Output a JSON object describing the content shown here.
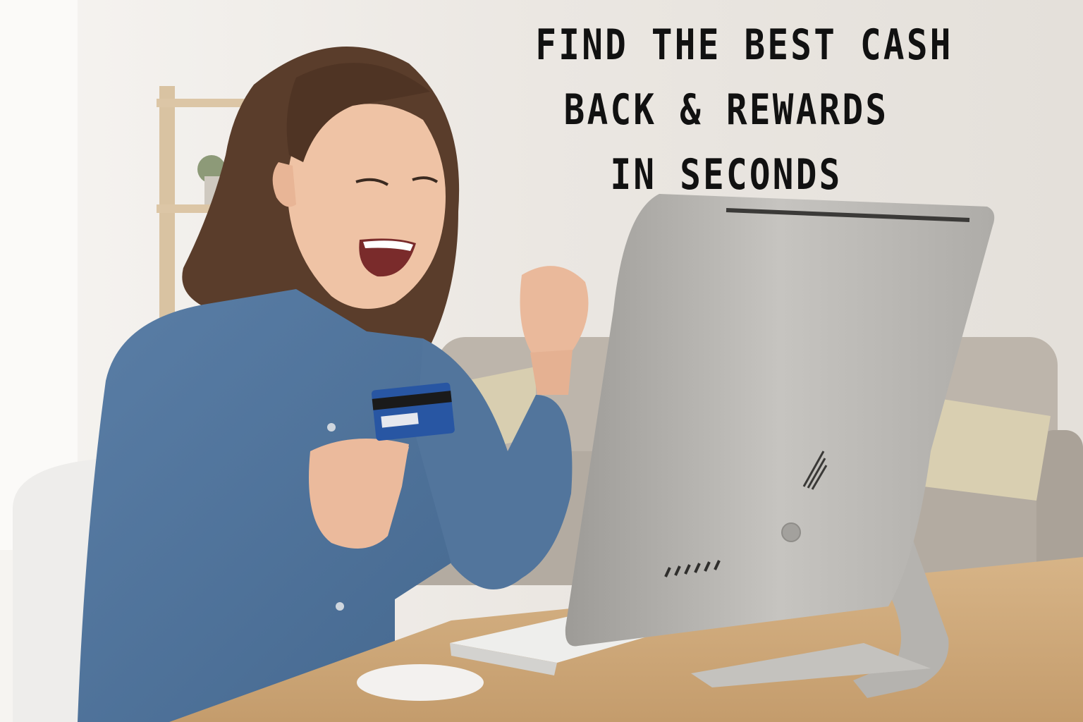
{
  "headline": {
    "lines": [
      "FIND THE BEST CASH",
      "BACK & REWARDS",
      "IN SECONDS"
    ]
  },
  "colors": {
    "wall": "#e9e6e2",
    "shirt": "#4f7197",
    "card": "#2856a3",
    "desk": "#cda77a",
    "monitor": "#b7b5b1",
    "sofa": "#b9b1a7",
    "text": "#111111"
  },
  "scene": {
    "subject": "woman-celebrating",
    "objects": [
      "credit-card",
      "desktop-monitor",
      "keyboard",
      "mouse",
      "sofa",
      "shelf",
      "chair"
    ]
  }
}
